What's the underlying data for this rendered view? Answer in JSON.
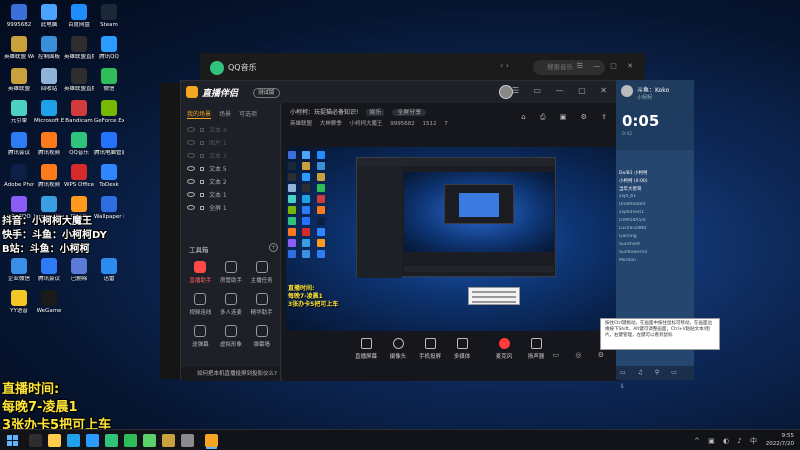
{
  "colors": {
    "accent": "#f5a623",
    "record_red": "#ff3b3b",
    "overlay_yellow": "#ffe438",
    "qq_green": "#31c27c",
    "win_blue": "#5db7ff"
  },
  "desktop": {
    "top_id": "9995682",
    "icons": [
      {
        "label": "9995682",
        "color": "#3a6fd8",
        "icon": "user-icon"
      },
      {
        "label": "此电脑",
        "color": "#4aa3ff",
        "icon": "computer-icon"
      },
      {
        "label": "百度网盘",
        "color": "#1f8cff",
        "icon": "cloud-icon"
      },
      {
        "label": "Steam",
        "color": "#1b2838",
        "icon": "steam-icon"
      },
      {
        "label": "英雄联盟 WeGame版",
        "color": "#c9a03c",
        "icon": "lol-icon"
      },
      {
        "label": "控制面板",
        "color": "#3a8fd9",
        "icon": "control-panel-icon"
      },
      {
        "label": "英雄联盟直播素材",
        "color": "#2e2e2e",
        "icon": "file-icon"
      },
      {
        "label": "腾讯QQ",
        "color": "#2b9bff",
        "icon": "qq-icon"
      },
      {
        "label": "英雄联盟",
        "color": "#c9a03c",
        "icon": "lol-icon"
      },
      {
        "label": "回收站",
        "color": "#8fb3d9",
        "icon": "recycle-bin-icon"
      },
      {
        "label": "英雄联盟直播bgm",
        "color": "#2e2e2e",
        "icon": "file-icon"
      },
      {
        "label": "微信",
        "color": "#2ebd59",
        "icon": "wechat-icon"
      },
      {
        "label": "元引擎",
        "color": "#4dd0c4",
        "icon": "engine-icon"
      },
      {
        "label": "Microsoft Edge",
        "color": "#1fa0e8",
        "icon": "edge-icon"
      },
      {
        "label": "Bandicam",
        "color": "#d13b3b",
        "icon": "bandicam-icon"
      },
      {
        "label": "GeForce Experience",
        "color": "#76b900",
        "icon": "geforce-icon"
      },
      {
        "label": "腾讯会议",
        "color": "#2d7cf6",
        "icon": "meeting-icon"
      },
      {
        "label": "腾讯视频",
        "color": "#ff7a1a",
        "icon": "video-icon"
      },
      {
        "label": "QQ音乐",
        "color": "#31c27c",
        "icon": "music-icon"
      },
      {
        "label": "腾讯电脑管家",
        "color": "#2672ff",
        "icon": "shield-icon"
      },
      {
        "label": "Adobe Photoshop",
        "color": "#0d1f46",
        "icon": "photoshop-icon"
      },
      {
        "label": "腾讯视频",
        "color": "#ff7a1a",
        "icon": "video-icon"
      },
      {
        "label": "WPS Office",
        "color": "#d52b2b",
        "icon": "wps-icon"
      },
      {
        "label": "ToDesk",
        "color": "#2f86ff",
        "icon": "todesk-icon"
      },
      {
        "label": "UPUPOO",
        "color": "#8b5cf6",
        "icon": "wallpaper-icon"
      },
      {
        "label": "LeagueDirector",
        "color": "#3a9fe0",
        "icon": "director-icon"
      },
      {
        "label": "向日葵",
        "color": "#ff9a1f",
        "icon": "sunflower-icon"
      },
      {
        "label": "Wallpaper Engine",
        "color": "#2d6ee0",
        "icon": "wallpaper-engine-icon"
      },
      {
        "label": "企业微信",
        "color": "#3a8fe8",
        "icon": "wework-icon"
      },
      {
        "label": "腾讯会议",
        "color": "#2d7cf6",
        "icon": "meeting-icon"
      },
      {
        "label": "已删除",
        "color": "#5a7bd8",
        "icon": "folder-icon"
      },
      {
        "label": "迅雷",
        "color": "#2a8cf0",
        "icon": "thunder-icon"
      },
      {
        "label": "YY语音",
        "color": "#f3c623",
        "icon": "yy-icon"
      },
      {
        "label": "WeGame",
        "color": "#1a1a1a",
        "icon": "wegame-icon"
      }
    ]
  },
  "overlay": {
    "douyin": "抖音：小柯柯大魔王",
    "kuaishou": "快手：斗鱼：小柯柯DY",
    "bilibili": "B站：斗鱼：小柯柯",
    "live_time_label": "直播时间:",
    "live_time": "每晚7-凌晨1",
    "promo": "3张办卡5把可上车"
  },
  "qq_music": {
    "title": "QQ音乐",
    "search_placeholder": "搜索音乐"
  },
  "app": {
    "name": "直播伴侣",
    "badge": "测试版",
    "left_tabs": [
      "我的场景",
      "场景",
      "可选项"
    ],
    "scenes": [
      {
        "label": "文本 4",
        "visible": false
      },
      {
        "label": "图片 1",
        "visible": false
      },
      {
        "label": "文本 3",
        "visible": false
      },
      {
        "label": "文本 5",
        "visible": true
      },
      {
        "label": "文本 2",
        "visible": true
      },
      {
        "label": "文本 1",
        "visible": true
      },
      {
        "label": "全屏 1",
        "visible": true
      }
    ],
    "tools_title": "工具箱",
    "tools": [
      {
        "label": "直播助手",
        "hot": true
      },
      {
        "label": "房管助手",
        "hot": false
      },
      {
        "label": "主播任务",
        "hot": false
      },
      {
        "label": "视频连线",
        "hot": false
      },
      {
        "label": "多人连麦",
        "hot": false
      },
      {
        "label": "精华助手",
        "hot": false
      },
      {
        "label": "送弹幕",
        "hot": false
      },
      {
        "label": "虚拟形象",
        "hot": false
      },
      {
        "label": "弹幕墙",
        "hot": false
      }
    ],
    "bottom_tip": "如何把本机直播投屏到投影仪么?",
    "room": {
      "name": "小柯柯：玩捉猫必备知识!",
      "tag1": "娱乐",
      "tag2": "全屏分享",
      "category": "英雄联盟",
      "category2": "大神赛季",
      "viewers": "小柯柯大魔王",
      "room_id": "9995682",
      "fans": "1512",
      "gifts": "7"
    },
    "preview_overlay": [
      "直播时间:",
      "每晚7-凌晨1",
      "3张办卡5把可上车"
    ],
    "toolbar": [
      {
        "label": "直播屏幕",
        "icon": "screen-icon"
      },
      {
        "label": "摄像头",
        "icon": "camera-icon"
      },
      {
        "label": "手机投屏",
        "icon": "mobile-icon"
      },
      {
        "label": "多媒体",
        "icon": "media-icon"
      },
      {
        "label": "麦克风",
        "icon": "mic-icon"
      },
      {
        "label": "扬声器",
        "icon": "speaker-icon"
      }
    ],
    "tooltip": "按住Ctrl键拖动，在画面中按住鼠标可移动，在画面边缘按下Shift，Alt键可调整画面，Ctrl+V粘贴文本/图片，右键管理，左键可以看到鼠标"
  },
  "chat": {
    "name": "斗鱼：Koko",
    "sub": "小柯柯",
    "timer": "0:05",
    "timer_sub": "0:42",
    "messages": [
      "Dx/B1 小柯柯",
      "小柯柯 (0:00)",
      "当年大佬哥",
      "sxjd_b1",
      "Undefeated",
      "sxjdidTest1",
      "lcl9954A5/6",
      "LucifarZ8N0",
      "Gaming",
      "Sunsheet",
      "Sunflower(ll)",
      "Mordon"
    ]
  },
  "taskbar": {
    "time": "9:55",
    "date": "2022/7/20"
  }
}
